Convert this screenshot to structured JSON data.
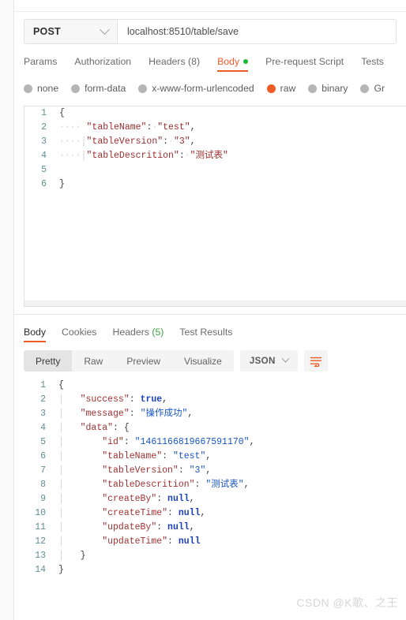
{
  "request": {
    "method": "POST",
    "url": "localhost:8510/table/save",
    "tabs": [
      {
        "label": "Params",
        "active": false,
        "dot": false
      },
      {
        "label": "Authorization",
        "active": false,
        "dot": false
      },
      {
        "label": "Headers (8)",
        "active": false,
        "dot": false
      },
      {
        "label": "Body",
        "active": true,
        "dot": true
      },
      {
        "label": "Pre-request Script",
        "active": false,
        "dot": false
      },
      {
        "label": "Tests",
        "active": false,
        "dot": false
      }
    ],
    "body_types": [
      {
        "label": "none",
        "selected": false
      },
      {
        "label": "form-data",
        "selected": false
      },
      {
        "label": "x-www-form-urlencoded",
        "selected": false
      },
      {
        "label": "raw",
        "selected": true
      },
      {
        "label": "binary",
        "selected": false
      },
      {
        "label": "Gr",
        "selected": false
      }
    ],
    "body_lines": [
      {
        "n": "1",
        "indent": 0,
        "guides": 0,
        "text": "{"
      },
      {
        "n": "2",
        "indent": 1,
        "guides": 0,
        "key": "tableName",
        "value": "test",
        "comma": true
      },
      {
        "n": "3",
        "indent": 1,
        "guides": 1,
        "key": "tableVersion",
        "value": "3",
        "comma": true
      },
      {
        "n": "4",
        "indent": 1,
        "guides": 1,
        "key": "tableDescrition",
        "value": "测试表",
        "comma": false
      },
      {
        "n": "5",
        "indent": 0,
        "guides": 0,
        "text": ""
      },
      {
        "n": "6",
        "indent": 0,
        "guides": 0,
        "text": "}"
      }
    ]
  },
  "response": {
    "tabs": [
      {
        "label": "Body",
        "count": "",
        "active": true
      },
      {
        "label": "Cookies",
        "count": "",
        "active": false
      },
      {
        "label": "Headers",
        "count": "(5)",
        "active": false
      },
      {
        "label": "Test Results",
        "count": "",
        "active": false
      }
    ],
    "view_modes": [
      {
        "label": "Pretty",
        "active": true
      },
      {
        "label": "Raw",
        "active": false
      },
      {
        "label": "Preview",
        "active": false
      },
      {
        "label": "Visualize",
        "active": false
      }
    ],
    "format": "JSON",
    "body_lines": [
      {
        "n": "1",
        "indent": 0,
        "guides": 0,
        "punct": "{"
      },
      {
        "n": "2",
        "indent": 1,
        "guides": 1,
        "key": "success",
        "lit": "true",
        "comma": true
      },
      {
        "n": "3",
        "indent": 1,
        "guides": 1,
        "key": "message",
        "str": "操作成功",
        "comma": true
      },
      {
        "n": "4",
        "indent": 1,
        "guides": 1,
        "key": "data",
        "punct": "{",
        "comma": false
      },
      {
        "n": "5",
        "indent": 2,
        "guides": 2,
        "key": "id",
        "str": "1461166819667591170",
        "comma": true
      },
      {
        "n": "6",
        "indent": 2,
        "guides": 2,
        "key": "tableName",
        "str": "test",
        "comma": true
      },
      {
        "n": "7",
        "indent": 2,
        "guides": 2,
        "key": "tableVersion",
        "str": "3",
        "comma": true
      },
      {
        "n": "8",
        "indent": 2,
        "guides": 2,
        "key": "tableDescrition",
        "str": "测试表",
        "comma": true
      },
      {
        "n": "9",
        "indent": 2,
        "guides": 2,
        "key": "createBy",
        "lit": "null",
        "comma": true
      },
      {
        "n": "10",
        "indent": 2,
        "guides": 2,
        "key": "createTime",
        "lit": "null",
        "comma": true
      },
      {
        "n": "11",
        "indent": 2,
        "guides": 2,
        "key": "updateBy",
        "lit": "null",
        "comma": true
      },
      {
        "n": "12",
        "indent": 2,
        "guides": 2,
        "key": "updateTime",
        "lit": "null",
        "comma": false
      },
      {
        "n": "13",
        "indent": 1,
        "guides": 1,
        "punct": "}"
      },
      {
        "n": "14",
        "indent": 0,
        "guides": 0,
        "punct": "}"
      }
    ]
  },
  "watermark": "CSDN @K歌、之王",
  "colors": {
    "accent": "#ef5b25",
    "ok_green": "#1bb934",
    "headers_count_green": "#43a047",
    "json_key": "#9c2d2d",
    "json_string": "#1a56c4",
    "json_literal": "#1a3fb8",
    "gutter": "#5f8f96"
  }
}
